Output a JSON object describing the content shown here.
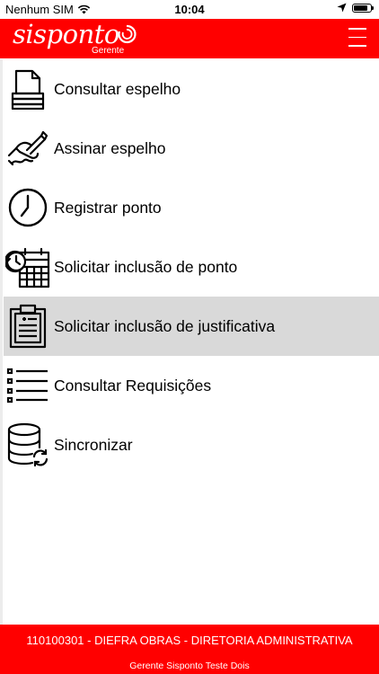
{
  "status_bar": {
    "carrier": "Nenhum SIM",
    "time": "10:04",
    "battery_level": 0.85
  },
  "header": {
    "brand": "sisponto",
    "subtitle": "Gerente",
    "background_color": "#ff0000"
  },
  "menu": {
    "items": [
      {
        "label": "Consultar espelho",
        "icon": "document-stack-icon"
      },
      {
        "label": "Assinar espelho",
        "icon": "signing-hand-icon"
      },
      {
        "label": "Registrar ponto",
        "icon": "clock-icon"
      },
      {
        "label": "Solicitar inclusão de ponto",
        "icon": "clock-calendar-icon"
      },
      {
        "label": "Solicitar inclusão de justificativa",
        "icon": "clipboard-icon",
        "selected": true
      },
      {
        "label": "Consultar Requisições",
        "icon": "checklist-icon"
      },
      {
        "label": "Sincronizar",
        "icon": "database-sync-icon"
      }
    ]
  },
  "footer": {
    "org": "110100301 - DIEFRA OBRAS - DIRETORIA ADMINISTRATIVA",
    "user": "Gerente Sisponto Teste Dois"
  },
  "colors": {
    "accent": "#ff0000",
    "selected_row": "#d9d9d9"
  }
}
